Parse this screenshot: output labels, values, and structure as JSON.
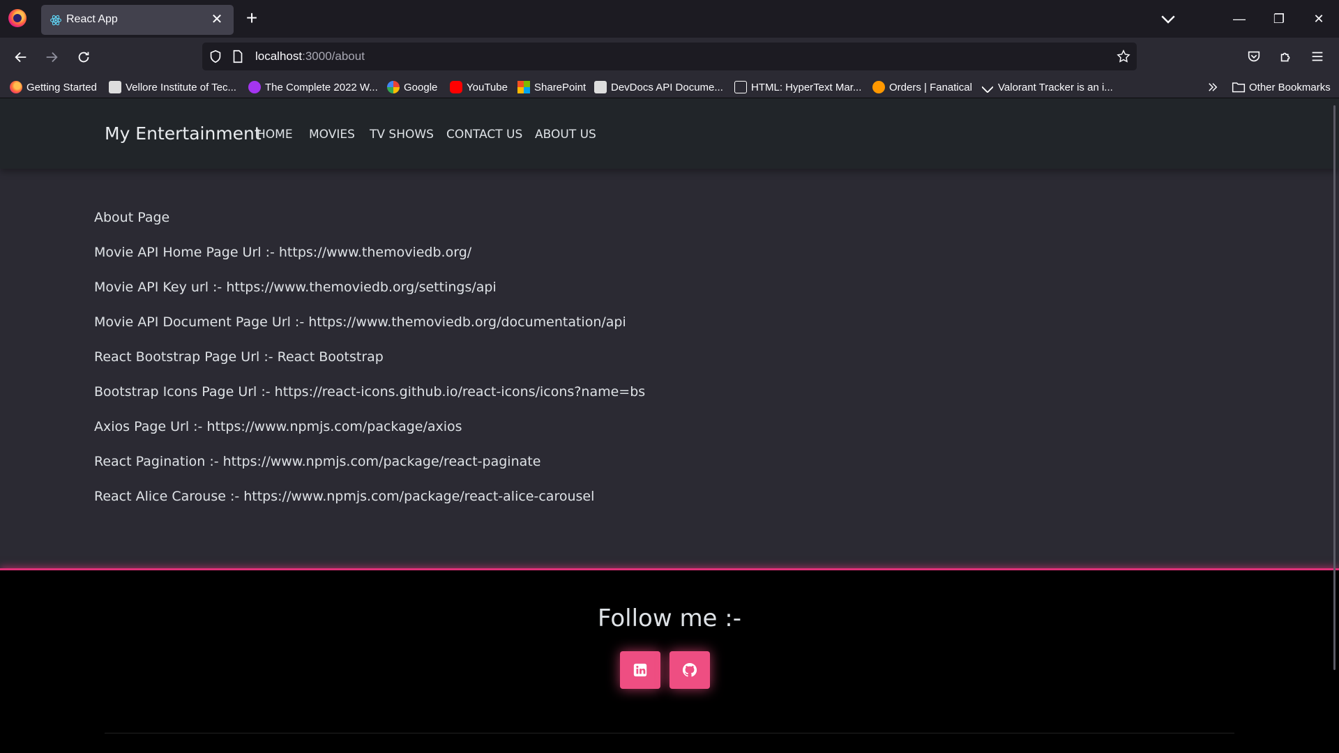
{
  "browser": {
    "tab_title": "React App",
    "tab_close_glyph": "✕",
    "new_tab_glyph": "+",
    "url_host": "localhost",
    "url_path": ":3000/about",
    "window_buttons": {
      "minimize": "—",
      "restore": "❐",
      "close": "✕"
    },
    "bookmarks": [
      {
        "label": "Getting Started",
        "icon": "firefox-icon",
        "color": "#ff7139"
      },
      {
        "label": "Vellore Institute of Tec...",
        "icon": "vit-icon",
        "color": "#dddddd"
      },
      {
        "label": "The Complete 2022 W...",
        "icon": "udemy-icon",
        "color": "#a435f0"
      },
      {
        "label": "Google",
        "icon": "google-icon",
        "color": "#4285f4"
      },
      {
        "label": "YouTube",
        "icon": "youtube-icon",
        "color": "#ff0000"
      },
      {
        "label": "SharePoint",
        "icon": "sharepoint-icon",
        "color": "#f25022"
      },
      {
        "label": "DevDocs API Docume...",
        "icon": "devdocs-icon",
        "color": "#dddddd"
      },
      {
        "label": "HTML: HyperText Mar...",
        "icon": "mdn-icon",
        "color": "#ffffff"
      },
      {
        "label": "Orders | Fanatical",
        "icon": "fanatical-icon",
        "color": "#ff9800"
      },
      {
        "label": "Valorant Tracker is an i...",
        "icon": "tracker-icon",
        "color": "#ffffff"
      }
    ],
    "other_bookmarks": "Other Bookmarks"
  },
  "app": {
    "brand": "My Entertainment",
    "nav": [
      "HOME",
      "MOVIES",
      "TV SHOWS",
      "CONTACT US",
      "ABOUT US"
    ],
    "about_lines": [
      "About Page",
      "Movie API Home Page Url :- https://www.themoviedb.org/",
      "Movie API Key url :- https://www.themoviedb.org/settings/api",
      "Movie API Document Page Url :- https://www.themoviedb.org/documentation/api",
      "React Bootstrap Page Url :- React Bootstrap",
      "Bootstrap Icons Page Url :- https://react-icons.github.io/react-icons/icons?name=bs",
      "Axios Page Url :- https://www.npmjs.com/package/axios",
      "React Pagination :- https://www.npmjs.com/package/react-paginate",
      "React Alice Carouse :- https://www.npmjs.com/package/react-alice-carousel"
    ],
    "footer_title": "Follow me :-",
    "social": [
      "linkedin-icon",
      "github-icon"
    ],
    "colors": {
      "accent": "#ee4e82",
      "footer_border": "#e0317a",
      "nav_bg": "#212529",
      "page_bg": "#2b2a33"
    }
  }
}
